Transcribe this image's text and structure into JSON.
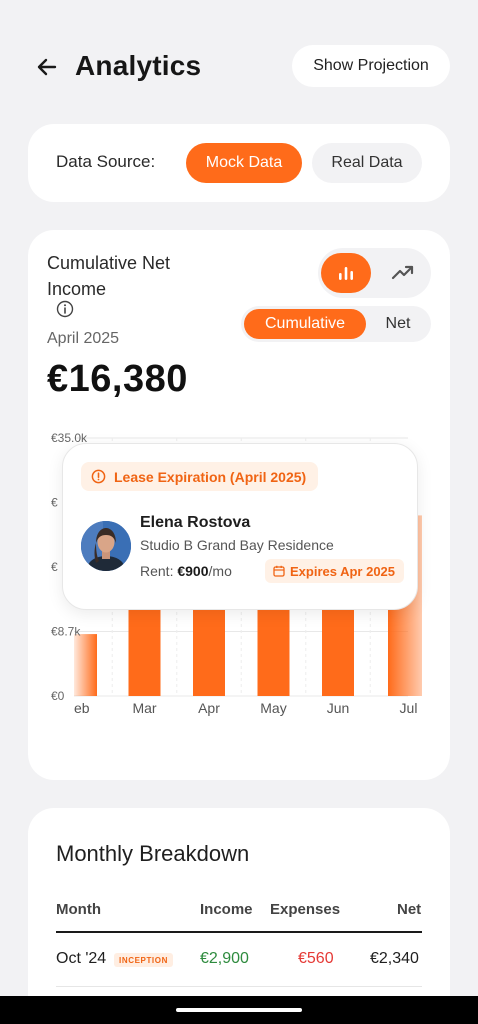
{
  "header": {
    "title": "Analytics",
    "projection_button": "Show Projection"
  },
  "data_source": {
    "label": "Data Source:",
    "options": [
      "Mock Data",
      "Real Data"
    ],
    "selected": "Mock Data"
  },
  "summary": {
    "title": "Cumulative Net Income",
    "month": "April 2025",
    "amount": "€16,380",
    "chart_types": [
      "bar-chart-icon",
      "trend-line-icon"
    ],
    "selected_chart_type": "bar-chart-icon",
    "modes": [
      "Cumulative",
      "Net"
    ],
    "selected_mode": "Cumulative"
  },
  "chart_data": {
    "type": "bar",
    "categories": [
      "Feb",
      "Mar",
      "Apr",
      "May",
      "Jun",
      "Jul"
    ],
    "x_labels_visible": [
      "eb",
      "Mar",
      "Apr",
      "May",
      "Jun",
      "Jul"
    ],
    "values": [
      8400,
      16380,
      16380,
      16380,
      16380,
      24500
    ],
    "ylim": [
      0,
      35000
    ],
    "yticks": [
      0,
      8750,
      17500,
      26250,
      35000
    ],
    "ytick_labels": [
      "€0",
      "€8.7k",
      "€",
      "€",
      "€35.0k"
    ],
    "bar_color": "#ff6b1a",
    "grid": true
  },
  "popup": {
    "tag": "Lease Expiration (April 2025)",
    "tenant_name": "Elena Rostova",
    "property": "Studio B Grand Bay Residence",
    "rent_label": "Rent:",
    "rent_value": "€900",
    "rent_period": "/mo",
    "expires": "Expires Apr 2025"
  },
  "breakdown": {
    "title": "Monthly Breakdown",
    "columns": [
      "Month",
      "Income",
      "Expenses",
      "Net"
    ],
    "rows": [
      {
        "month": "Oct '24",
        "badge": "INCEPTION",
        "income": "€2,900",
        "expenses": "€560",
        "net": "€2,340"
      }
    ]
  },
  "colors": {
    "accent": "#ff6b1a",
    "income": "#2e8b3e",
    "expense": "#e53935",
    "background": "#f2f2f4"
  }
}
